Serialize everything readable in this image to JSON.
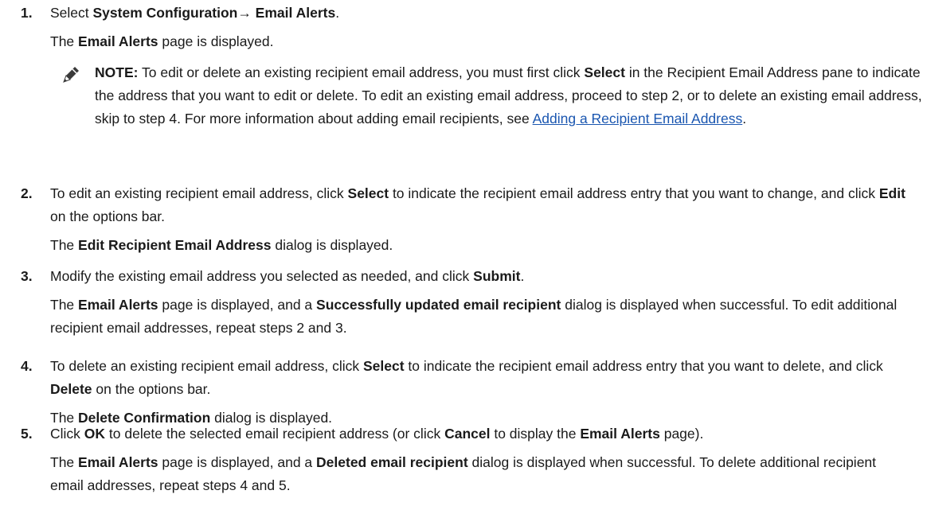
{
  "step1": {
    "number": "1.",
    "lead": "Select ",
    "menu_path": "System Configuration→ Email Alerts",
    "end": ".",
    "result_pre": "The ",
    "result_page": "Email Alerts",
    "result_post": " page is displayed."
  },
  "note": {
    "icon": "pencil-icon",
    "label": "NOTE:",
    "t1": " To edit or delete an existing recipient email address, you must first click ",
    "b1": "Select",
    "t2": " in the Recipient Email Address pane to indicate the address that you want to edit or delete. To edit an existing email address, proceed to step 2, or to delete an existing email address, skip to step 4. For more information about adding email recipients, see ",
    "link": "Adding a Recipient Email Address",
    "t3": "."
  },
  "step2": {
    "number": "2.",
    "t1": "To edit an existing recipient email address, click ",
    "b1": "Select",
    "t2": " to indicate the recipient email address entry that you want to change, and click ",
    "b2": "Edit",
    "t3": " on the options bar.",
    "result_pre": "The ",
    "result_dialog": "Edit Recipient Email Address",
    "result_post": " dialog is displayed."
  },
  "step3": {
    "number": "3.",
    "t1": "Modify the existing email address you selected as needed, and click ",
    "b1": "Submit",
    "t2": ".",
    "r1": "The ",
    "rb1": "Email Alerts",
    "r2": " page is displayed, and a ",
    "rb2": "Successfully updated email recipient",
    "r3": " dialog is displayed when successful. To edit additional recipient email addresses, repeat steps 2 and 3."
  },
  "step4": {
    "number": "4.",
    "t1": "To delete an existing recipient email address, click ",
    "b1": "Select",
    "t2": " to indicate the recipient email address entry that you want to delete, and click ",
    "b2": "Delete",
    "t3": " on the options bar.",
    "r1": "The ",
    "rb1": "Delete Confirmation",
    "r2": " dialog is displayed."
  },
  "step5": {
    "number": "5.",
    "t1": "Click ",
    "b1": "OK",
    "t2": " to delete the selected email recipient address (or click ",
    "b2": "Cancel",
    "t3": " to display the ",
    "b3": "Email Alerts",
    "t4": " page).",
    "r1": "The ",
    "rb1": "Email Alerts",
    "r2": " page is displayed, and a ",
    "rb2": "Deleted email recipient",
    "r3": " dialog is displayed when successful. To delete additional recipient email addresses, repeat steps 4 and 5."
  }
}
